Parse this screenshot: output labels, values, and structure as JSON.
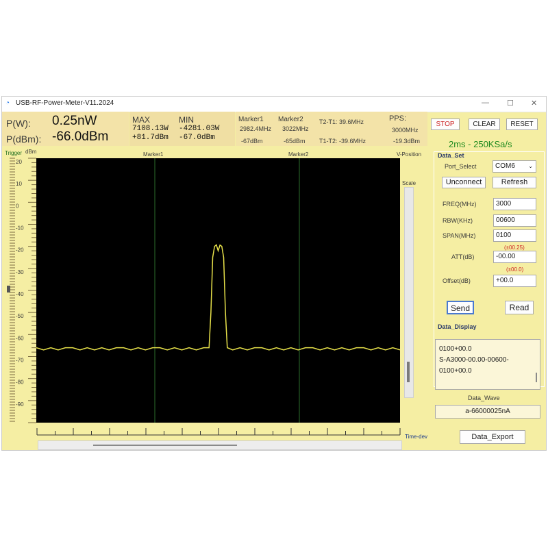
{
  "window": {
    "title": "USB-RF-Power-Meter-V11.2024",
    "min": "—",
    "max": "☐",
    "close": "✕"
  },
  "readout": {
    "p_w_label": "P(W):",
    "p_w_value": "0.25nW",
    "p_dbm_label": "P(dBm):",
    "p_dbm_value": "-66.0dBm",
    "max_label": "MAX",
    "max_w": "7108.13W",
    "max_dbm": "+81.7dBm",
    "min_label": "MIN",
    "min_w": "-4281.03W",
    "min_dbm": "-67.0dBm",
    "marker1_label": "Marker1",
    "marker1_freq": "2982.4MHz",
    "marker1_dbm": "-67dBm",
    "marker2_label": "Marker2",
    "marker2_freq": "3022MHz",
    "marker2_dbm": "-65dBm",
    "t2t1": "T2-T1: 39.6MHz",
    "t1t2": "T1-T2: -39.6MHz",
    "pps_label": "PPS:",
    "pps_freq": "3000MHz",
    "pps_dbm": "-19.3dBm"
  },
  "plot": {
    "trigger_label": "Trigger",
    "unit_label": "dBm",
    "marker1_label": "Marker1",
    "marker2_label": "Marker2",
    "vposition_label": "V-Position",
    "scale_label": "Scale",
    "timedev_label": "Time-dev",
    "y_ticks": [
      "20",
      "10",
      "0",
      "-10",
      "-20",
      "-30",
      "-40",
      "-50",
      "-60",
      "-70",
      "-80",
      "-90"
    ],
    "trace_color": "#e8e24a",
    "marker_color": "#2c6e2c",
    "background": "#000000"
  },
  "chart_data": {
    "type": "line",
    "xlabel": "",
    "ylabel": "dBm",
    "ylim": [
      -100,
      20
    ],
    "x": [
      0,
      2,
      4,
      6,
      8,
      10,
      12,
      14,
      16,
      18,
      20,
      22,
      24,
      26,
      28,
      30,
      32,
      34,
      36,
      38,
      40,
      42,
      44,
      46,
      48,
      50,
      52,
      54,
      56,
      58,
      60,
      62,
      64,
      66,
      68,
      70,
      72,
      74,
      76,
      78,
      80,
      82,
      84,
      86,
      88,
      90,
      92,
      94,
      96,
      98,
      100
    ],
    "values": [
      -66,
      -67,
      -66,
      -67,
      -66,
      -66,
      -67,
      -66,
      -67,
      -66,
      -67,
      -66,
      -66,
      -67,
      -66,
      -67,
      -66,
      -66,
      -67,
      -66,
      -67,
      -66,
      -67,
      -66,
      -66,
      -67,
      -66,
      -67,
      -66,
      -67,
      -66,
      -66,
      -67,
      -66,
      -67,
      -66,
      -67,
      -66,
      -66,
      -67,
      -66,
      -67,
      -66,
      -67,
      -66,
      -66,
      -67,
      -66,
      -67,
      -66,
      -67
    ],
    "peak": {
      "x": [
        47.5,
        48,
        48.5,
        49,
        49.5,
        50,
        50.5,
        51,
        51.5,
        52,
        52.5
      ],
      "values": [
        -66,
        -50,
        -25,
        -20,
        -19.3,
        -22,
        -19.4,
        -20,
        -25,
        -50,
        -66
      ]
    }
  },
  "controls": {
    "stop": "STOP",
    "clear": "CLEAR",
    "reset": "RESET",
    "rate": "2ms - 250KSa/s",
    "data_set": "Data_Set",
    "port_select": "Port_Select",
    "port_value": "COM6",
    "unconnect": "Unconnect",
    "refresh": "Refresh",
    "freq_label": "FREQ(MHz)",
    "freq_value": "3000",
    "rbw_label": "RBW(KHz)",
    "rbw_value": "00600",
    "span_label": "SPAN(MHz)",
    "span_value": "0100",
    "att_hint": "(±00.25)",
    "att_label": "ATT(dB)",
    "att_value": "-00.00",
    "offset_hint": "(±00.0)",
    "offset_label": "Offset(dB)",
    "offset_value": "+00.0",
    "send": "Send",
    "read": "Read",
    "data_display": "Data_Display",
    "display_lines": [
      "0100+00.0",
      "S-A3000-00.00-00600-",
      "0100+00.0"
    ],
    "data_wave": "Data_Wave",
    "data_wave_value": "a-66000025nA",
    "data_export": "Data_Export"
  },
  "colors": {
    "accent_green": "#1f8a1f",
    "hint_red": "#cc2222",
    "stop_red": "#cc2222",
    "panel": "#f5eea3"
  }
}
